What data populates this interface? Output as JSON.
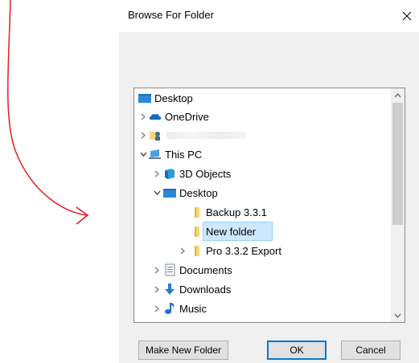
{
  "dialog": {
    "title": "Browse For Folder",
    "close_icon": "close-icon"
  },
  "tree": {
    "items": [
      {
        "label": "Desktop",
        "icon": "desktop-folder-icon",
        "expander": ""
      },
      {
        "label": "OneDrive",
        "icon": "onedrive-cloud-icon",
        "expander": ">"
      },
      {
        "label": "",
        "icon": "user-folder-icon",
        "expander": ">"
      },
      {
        "label": "This PC",
        "icon": "computer-icon",
        "expander": "v"
      },
      {
        "label": "3D Objects",
        "icon": "3d-objects-icon",
        "expander": ">"
      },
      {
        "label": "Desktop",
        "icon": "desktop-folder-icon",
        "expander": "v"
      },
      {
        "label": "Backup 3.3.1",
        "icon": "folder-icon",
        "expander": ""
      },
      {
        "label": "New folder",
        "icon": "folder-icon",
        "expander": "",
        "selected": true
      },
      {
        "label": "Pro 3.3.2 Export",
        "icon": "folder-icon",
        "expander": ">"
      },
      {
        "label": "Documents",
        "icon": "documents-icon",
        "expander": ">"
      },
      {
        "label": "Downloads",
        "icon": "downloads-icon",
        "expander": ">"
      },
      {
        "label": "Music",
        "icon": "music-icon",
        "expander": ">"
      }
    ]
  },
  "buttons": {
    "make_new_folder": "Make New Folder",
    "ok": "OK",
    "cancel": "Cancel"
  },
  "colors": {
    "selection": "#cce8ff",
    "annotation_arrow": "#e02020",
    "folder_yellow": "#f8d775",
    "desktop_blue": "#2b88d8"
  }
}
